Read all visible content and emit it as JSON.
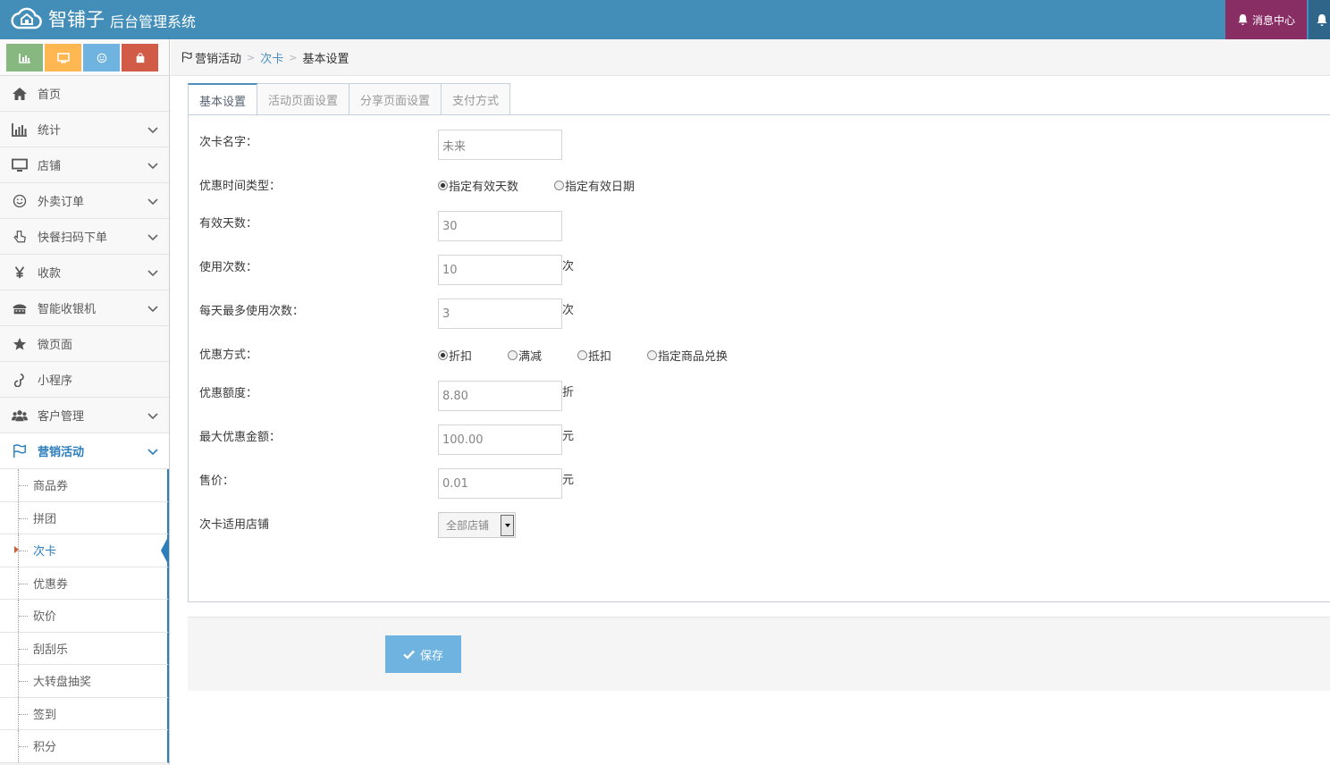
{
  "app": {
    "brand": "智铺子",
    "subtitle": "后台管理系统"
  },
  "header": {
    "message_center": "消息中心"
  },
  "colors": {
    "topbar": "#438eb9",
    "message_btn": "#892e65",
    "accent": "#2b7dbc",
    "shortcut_1": "#87b87f",
    "shortcut_2": "#ffb752",
    "shortcut_3": "#6fb3e0",
    "shortcut_4": "#d15b47"
  },
  "shortcuts": [
    {
      "icon": "bar-chart-icon"
    },
    {
      "icon": "desktop-icon"
    },
    {
      "icon": "smile-icon"
    },
    {
      "icon": "shopping-bag-icon"
    }
  ],
  "sidebar": {
    "items": [
      {
        "label": "首页",
        "icon": "home-icon"
      },
      {
        "label": "统计",
        "icon": "bar-chart-icon"
      },
      {
        "label": "店铺",
        "icon": "desktop-icon"
      },
      {
        "label": "外卖订单",
        "icon": "smile-icon"
      },
      {
        "label": "快餐扫码下单",
        "icon": "hand-pointer-icon"
      },
      {
        "label": "收款",
        "icon": "yen-icon"
      },
      {
        "label": "智能收银机",
        "icon": "cash-register-icon"
      },
      {
        "label": "微页面",
        "icon": "star-icon"
      },
      {
        "label": "小程序",
        "icon": "music-note-icon"
      },
      {
        "label": "客户管理",
        "icon": "users-icon"
      },
      {
        "label": "营销活动",
        "icon": "flag-icon"
      }
    ],
    "sub_items": [
      {
        "label": "商品券"
      },
      {
        "label": "拼团"
      },
      {
        "label": "次卡"
      },
      {
        "label": "优惠券"
      },
      {
        "label": "砍价"
      },
      {
        "label": "刮刮乐"
      },
      {
        "label": "大转盘抽奖"
      },
      {
        "label": "签到"
      },
      {
        "label": "积分"
      }
    ]
  },
  "breadcrumb": {
    "root": "营销活动",
    "parent": "次卡",
    "current": "基本设置"
  },
  "tabs": [
    {
      "label": "基本设置"
    },
    {
      "label": "活动页面设置"
    },
    {
      "label": "分享页面设置"
    },
    {
      "label": "支付方式"
    }
  ],
  "form": {
    "name": {
      "label": "次卡名字：",
      "value": "未来"
    },
    "time_type": {
      "label": "优惠时间类型：",
      "options": [
        "指定有效天数",
        "指定有效日期"
      ],
      "selected": "指定有效天数"
    },
    "valid_days": {
      "label": "有效天数：",
      "value": "30"
    },
    "use_count": {
      "label": "使用次数：",
      "value": "10",
      "unit": "次"
    },
    "daily_max": {
      "label": "每天最多使用次数：",
      "value": "3",
      "unit": "次"
    },
    "discount_type": {
      "label": "优惠方式：",
      "options": [
        "折扣",
        "满减",
        "抵扣",
        "指定商品兑换"
      ],
      "selected": "折扣"
    },
    "discount_amount": {
      "label": "优惠额度：",
      "value": "8.80",
      "unit": "折"
    },
    "max_discount": {
      "label": "最大优惠金额：",
      "value": "100.00",
      "unit": "元"
    },
    "price": {
      "label": "售价：",
      "value": "0.01",
      "unit": "元"
    },
    "stores": {
      "label": "次卡适用店铺",
      "value": "全部店铺"
    }
  },
  "actions": {
    "save": "保存"
  }
}
